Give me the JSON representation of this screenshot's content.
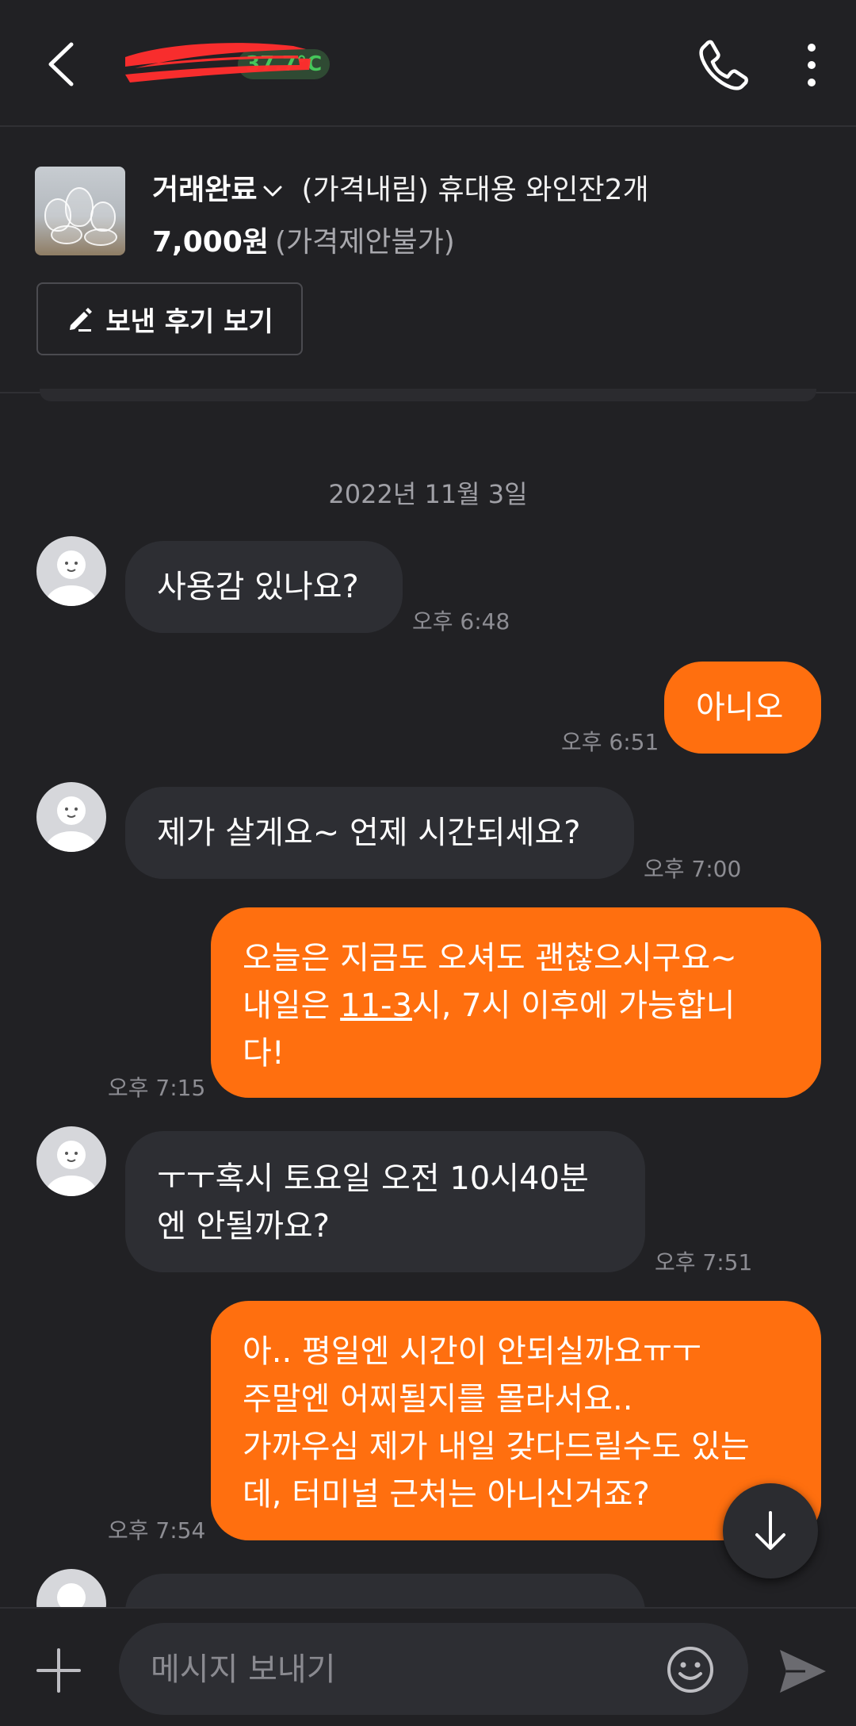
{
  "header": {
    "temperature": "37.7°C",
    "colors": {
      "temp_text": "#46c75b",
      "redaction": "#ff2d2d"
    }
  },
  "product": {
    "status": "거래완료",
    "name": "(가격내림) 휴대용 와인잔2개",
    "price": "7,000원",
    "price_note": "(가격제안불가)",
    "review_button": "보낸 후기 보기"
  },
  "chat": {
    "date": "2022년 11월 3일",
    "messages": [
      {
        "side": "in",
        "lines": [
          "사용감 있나요?"
        ],
        "time": "오후 6:48"
      },
      {
        "side": "out",
        "lines": [
          "아니오"
        ],
        "time": "오후 6:51"
      },
      {
        "side": "in",
        "lines": [
          "제가 살게요~ 언제 시간되세요?"
        ],
        "time": "오후 7:00"
      },
      {
        "side": "out",
        "lines": [
          "오늘은 지금도 오셔도 괜찮으시구요~",
          "내일은 ",
          "11-3",
          "시, 7시 이후에 가능합니",
          "다!"
        ],
        "time": "오후 7:15"
      },
      {
        "side": "in",
        "lines": [
          "ㅜㅜ혹시 토요일 오전 10시40분",
          "엔 안될까요?"
        ],
        "time": "오후 7:51"
      },
      {
        "side": "out",
        "lines": [
          "아.. 평일엔 시간이 안되실까요ㅠㅜ",
          "주말엔 어찌될지를 몰라서요..",
          "가까우심 제가 내일 갖다드릴수도 있는",
          "데, 터미널 근처는 아니신거죠?"
        ],
        "time": "오후 7:54"
      }
    ]
  },
  "composer": {
    "placeholder": "메시지 보내기"
  },
  "icons": [
    "back-icon",
    "phone-icon",
    "more-icon",
    "chevron-down-icon",
    "pencil-icon",
    "arrow-down-icon",
    "plus-icon",
    "emoji-icon",
    "send-icon"
  ],
  "colors": {
    "background": "#212124",
    "outgoing_bubble": "#ff6f0f",
    "incoming_bubble": "#2d2e33"
  }
}
